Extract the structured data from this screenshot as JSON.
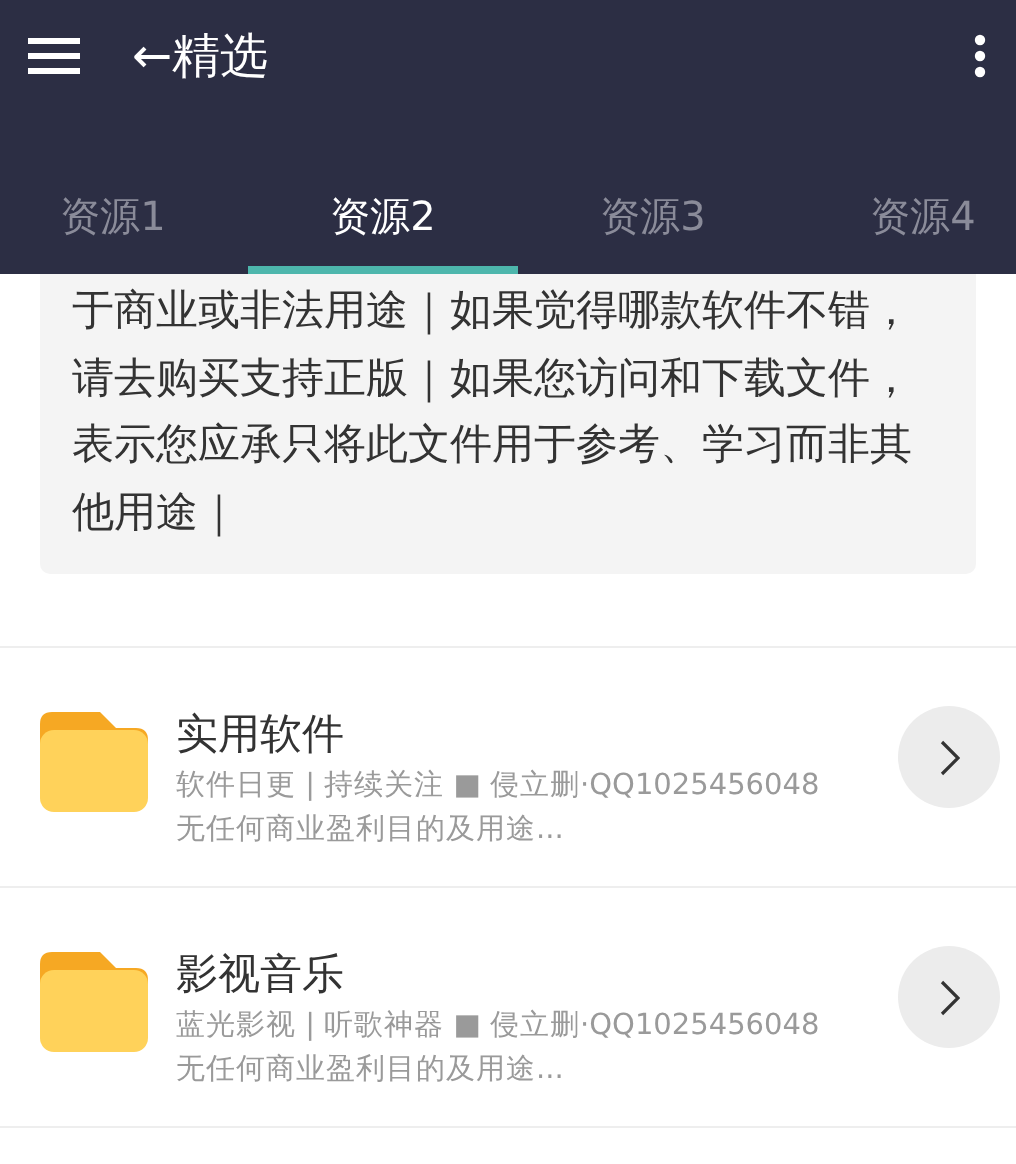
{
  "header": {
    "title": "←精选"
  },
  "tabs": [
    {
      "label": "资源1",
      "selected": false
    },
    {
      "label": "资源2",
      "selected": true
    },
    {
      "label": "资源3",
      "selected": false
    },
    {
      "label": "资源4",
      "selected": false
    }
  ],
  "notice": {
    "text": "于商业或非法用途｜如果觉得哪款软件不错，请去购买支持正版｜如果您访问和下载文件，表示您应承只将此文件用于参考、学习而非其他用途｜"
  },
  "folders": [
    {
      "title": "实用软件",
      "subtitle": "软件日更 | 持续关注 ■ 侵立删·QQ1025456048",
      "description": "无任何商业盈利目的及用途..."
    },
    {
      "title": "影视音乐",
      "subtitle": "蓝光影视 | 听歌神器 ■ 侵立删·QQ1025456048",
      "description": "无任何商业盈利目的及用途..."
    }
  ]
}
